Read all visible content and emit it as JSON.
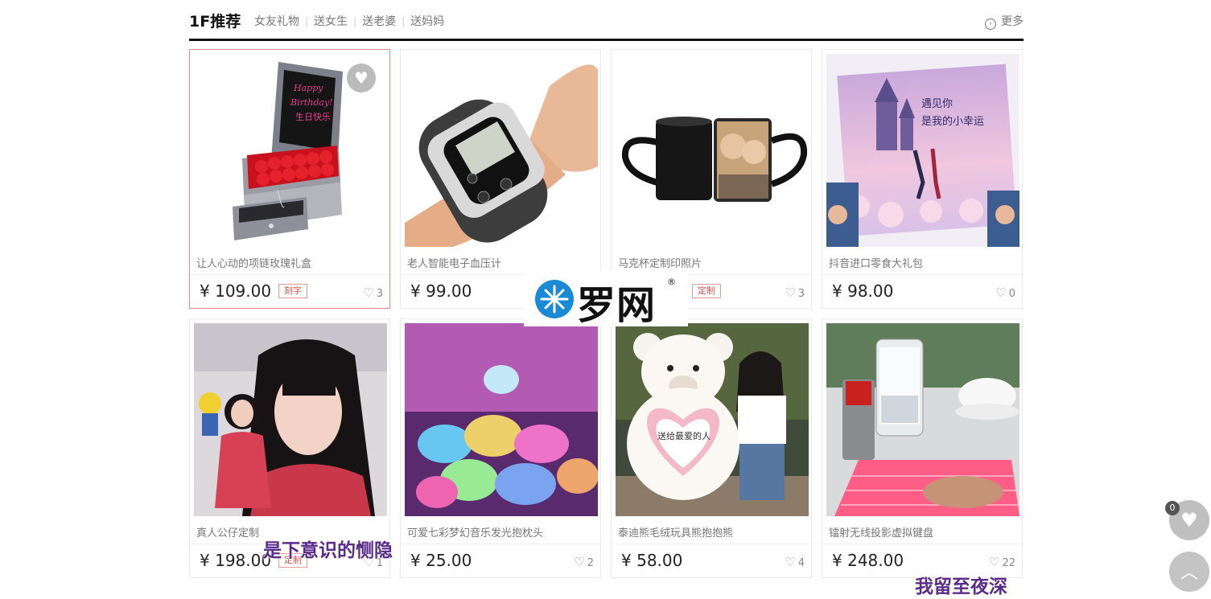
{
  "floor": {
    "title": "1F推荐",
    "tabs": [
      "女友礼物",
      "送女生",
      "送老婆",
      "送妈妈"
    ],
    "more_label": "更多"
  },
  "currency": "¥",
  "products": [
    {
      "name": "让人心动的项链玫瑰礼盒",
      "price": "109.00",
      "tag": "刻字",
      "likes": "3",
      "fav_icon": "heart-icon"
    },
    {
      "name": "老人智能电子血压计",
      "price": "99.00",
      "tag": "",
      "likes": ""
    },
    {
      "name": "马克杯定制印照片",
      "price": "",
      "tag": "定制",
      "likes": "3"
    },
    {
      "name": "抖音进口零食大礼包",
      "price": "98.00",
      "tag": "",
      "likes": "0"
    },
    {
      "name": "真人公仔定制",
      "price": "198.00",
      "tag": "定制",
      "likes": "1"
    },
    {
      "name": "可爱七彩梦幻音乐发光抱枕头",
      "price": "25.00",
      "tag": "",
      "likes": "2"
    },
    {
      "name": "泰迪熊毛绒玩具熊抱抱熊",
      "price": "58.00",
      "tag": "",
      "likes": "4"
    },
    {
      "name": "镭射无线投影虚拟键盘",
      "price": "248.00",
      "tag": "",
      "likes": "22"
    }
  ],
  "image_texts": {
    "birthday_box": [
      "Happy",
      "Birthday!",
      "生日快乐"
    ],
    "snack_box": [
      "遇见你",
      "是我的小幸运"
    ],
    "bear_heart": "送给最爱的人"
  },
  "watermark": {
    "text": "罗网",
    "reg": "®"
  },
  "captions": {
    "bottom_left": "是下意识的恻隐",
    "bottom_right": "我留至夜深"
  },
  "side": {
    "fav_count": "0"
  },
  "colors": {
    "active_border": "#e7898f",
    "tag_red": "#d9534f",
    "header_line": "#111111"
  }
}
